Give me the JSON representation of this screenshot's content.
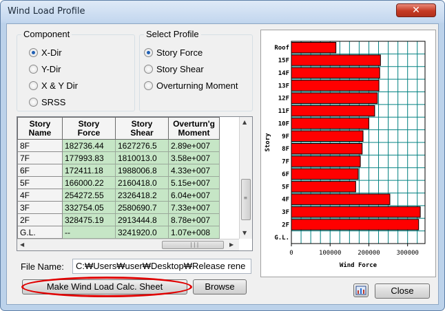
{
  "window": {
    "title": "Wind Load Profile",
    "close_glyph": "✕"
  },
  "component": {
    "title": "Component",
    "options": [
      "X-Dir",
      "Y-Dir",
      "X & Y Dir",
      "SRSS"
    ],
    "selected": 0
  },
  "select_profile": {
    "title": "Select Profile",
    "options": [
      "Story Force",
      "Story Shear",
      "Overturning Moment"
    ],
    "selected": 0
  },
  "table": {
    "headers": [
      [
        "Story",
        "Name"
      ],
      [
        "Story",
        "Force"
      ],
      [
        "Story",
        "Shear"
      ],
      [
        "Overturn'g",
        "Moment"
      ]
    ],
    "rows": [
      [
        "8F",
        "182736.44",
        "1627276.5",
        "2.89e+007"
      ],
      [
        "7F",
        "177993.83",
        "1810013.0",
        "3.58e+007"
      ],
      [
        "6F",
        "172411.18",
        "1988006.8",
        "4.33e+007"
      ],
      [
        "5F",
        "166000.22",
        "2160418.0",
        "5.15e+007"
      ],
      [
        "4F",
        "254272.55",
        "2326418.2",
        "6.04e+007"
      ],
      [
        "3F",
        "332754.05",
        "2580690.7",
        "7.33e+007"
      ],
      [
        "2F",
        "328475.19",
        "2913444.8",
        "8.78e+007"
      ],
      [
        "G.L.",
        "--",
        "3241920.0",
        "1.07e+008"
      ]
    ]
  },
  "file": {
    "label": "File Name:",
    "value": "C:₩Users₩user₩Desktop₩Release rene"
  },
  "buttons": {
    "make": "Make Wind Load Calc. Sheet",
    "browse": "Browse",
    "close": "Close"
  },
  "icons": {
    "chart_button": "bar-chart-icon"
  },
  "colors": {
    "bar": "#ff0000",
    "grid": "#008080",
    "cell": "#c6e6c6"
  },
  "chart_data": {
    "type": "bar",
    "orientation": "horizontal",
    "categories": [
      "Roof",
      "15F",
      "14F",
      "13F",
      "12F",
      "11F",
      "10F",
      "9F",
      "8F",
      "7F",
      "6F",
      "5F",
      "4F",
      "3F",
      "2F",
      "G.L."
    ],
    "values": [
      115000,
      230000,
      228000,
      226000,
      222000,
      215000,
      200000,
      185000,
      182736.44,
      177993.83,
      172411.18,
      166000.22,
      254272.55,
      332754.05,
      328475.19,
      0
    ],
    "xlabel": "Wind Force",
    "ylabel": "Story",
    "xlim": [
      0,
      345000
    ],
    "xticks": [
      0,
      100000,
      200000,
      300000
    ],
    "xtick_labels": [
      "0",
      "100000",
      "200000",
      "300000"
    ],
    "grid": true
  }
}
